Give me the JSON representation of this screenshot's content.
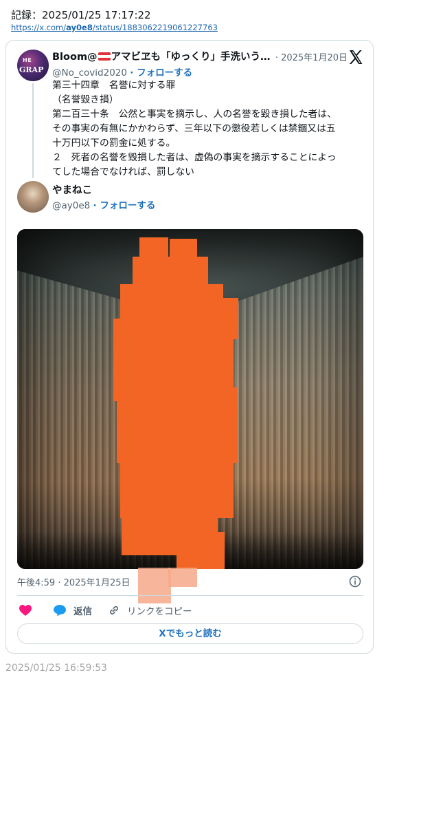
{
  "record": {
    "title": "記録：2025/01/25 17:17:22",
    "url_prefix": "https://x.com/",
    "url_user": "ay0e8",
    "url_suffix": "/status/1883062219061227763"
  },
  "quoted_tweet": {
    "avatar_text_top": "HE",
    "avatar_text_bottom": "GRAP",
    "name_start": "Bloom@",
    "name_rest": "アマビヱも「ゆっくり」手洗いう…",
    "date": "· 2025年1月20日",
    "handle": "@No_covid2020",
    "follow": "· フォローする",
    "lines": [
      "第三十四章　名誉に対する罪",
      "（名誉毀き損）",
      "第二百三十条　公然と事実を摘示し、人の名誉を毀き損した者は、",
      "その事実の有無にかかわらず、三年以下の懲役若しくは禁錮又は五",
      "十万円以下の罰金に処する。",
      "２　死者の名誉を毀損した者は、虚偽の事実を摘示することによっ",
      "てした場合でなければ、罰しない"
    ]
  },
  "reply_tweet": {
    "name": "やまねこ",
    "handle": "@ay0e8",
    "follow": "· フォローする",
    "timestamp": "午後4:59 · 2025年1月25日"
  },
  "actions": {
    "reply": "返信",
    "copy_link": "リンクをコピー",
    "read_more": "Xでもっと読む"
  },
  "footer_stamp": "2025/01/25 16:59:53",
  "icons": [
    "x-logo-icon",
    "heart-icon",
    "reply-bubble-icon",
    "link-icon",
    "info-icon"
  ],
  "colors": {
    "link": "#1d6fbf",
    "heart": "#f91880",
    "reply": "#1d9bf0",
    "redaction": "#f26525"
  }
}
